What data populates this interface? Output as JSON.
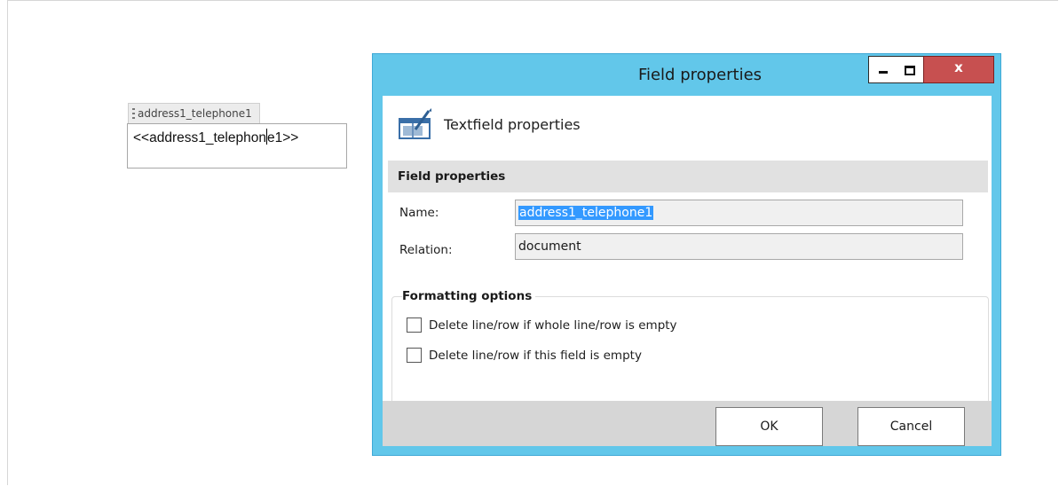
{
  "document": {
    "field_tag": "address1_telephone1",
    "field_value_before_caret": "<<address1_telephon",
    "field_value_after_caret": "e1>>"
  },
  "dialog": {
    "title": "Field properties",
    "close_label": "x",
    "header_label": "Textfield properties",
    "section_title": "Field properties",
    "name_label": "Name:",
    "name_value": "address1_telephone1",
    "relation_label": "Relation:",
    "relation_value": "document",
    "formatting_title": "Formatting options",
    "options": [
      {
        "label": "Delete line/row if whole line/row is empty",
        "checked": false
      },
      {
        "label": "Delete line/row if this field is empty",
        "checked": false
      }
    ],
    "ok_label": "OK",
    "cancel_label": "Cancel"
  },
  "colors": {
    "dialog_frame": "#62c7ea",
    "close_button": "#c75050",
    "selection": "#3399ff"
  }
}
